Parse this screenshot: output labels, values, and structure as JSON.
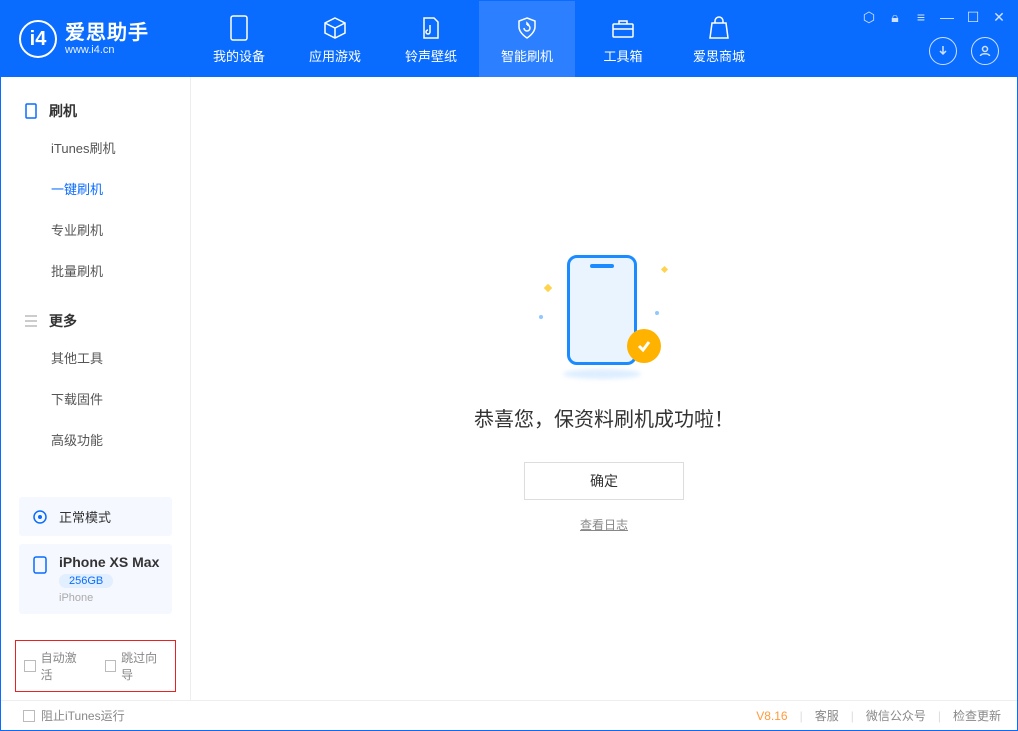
{
  "brand": {
    "title": "爱思助手",
    "subtitle": "www.i4.cn",
    "logo_letter": "i4"
  },
  "toptabs": {
    "device": "我的设备",
    "apps": "应用游戏",
    "wallpaper": "铃声壁纸",
    "flash": "智能刷机",
    "toolbox": "工具箱",
    "store": "爱思商城"
  },
  "sidebar": {
    "flash_group": "刷机",
    "items": {
      "itunes": "iTunes刷机",
      "oneclick": "一键刷机",
      "pro": "专业刷机",
      "batch": "批量刷机"
    },
    "more_group": "更多",
    "more_items": {
      "othertools": "其他工具",
      "firmware": "下载固件",
      "advanced": "高级功能"
    },
    "mode_label": "正常模式",
    "device": {
      "name": "iPhone XS Max",
      "storage": "256GB",
      "type": "iPhone"
    },
    "checkboxes": {
      "auto_activate": "自动激活",
      "skip_setup": "跳过向导"
    }
  },
  "main": {
    "success_message": "恭喜您，保资料刷机成功啦！",
    "ok_button": "确定",
    "view_log": "查看日志"
  },
  "statusbar": {
    "block_itunes": "阻止iTunes运行",
    "version": "V8.16",
    "support": "客服",
    "wechat": "微信公众号",
    "update": "检查更新"
  }
}
